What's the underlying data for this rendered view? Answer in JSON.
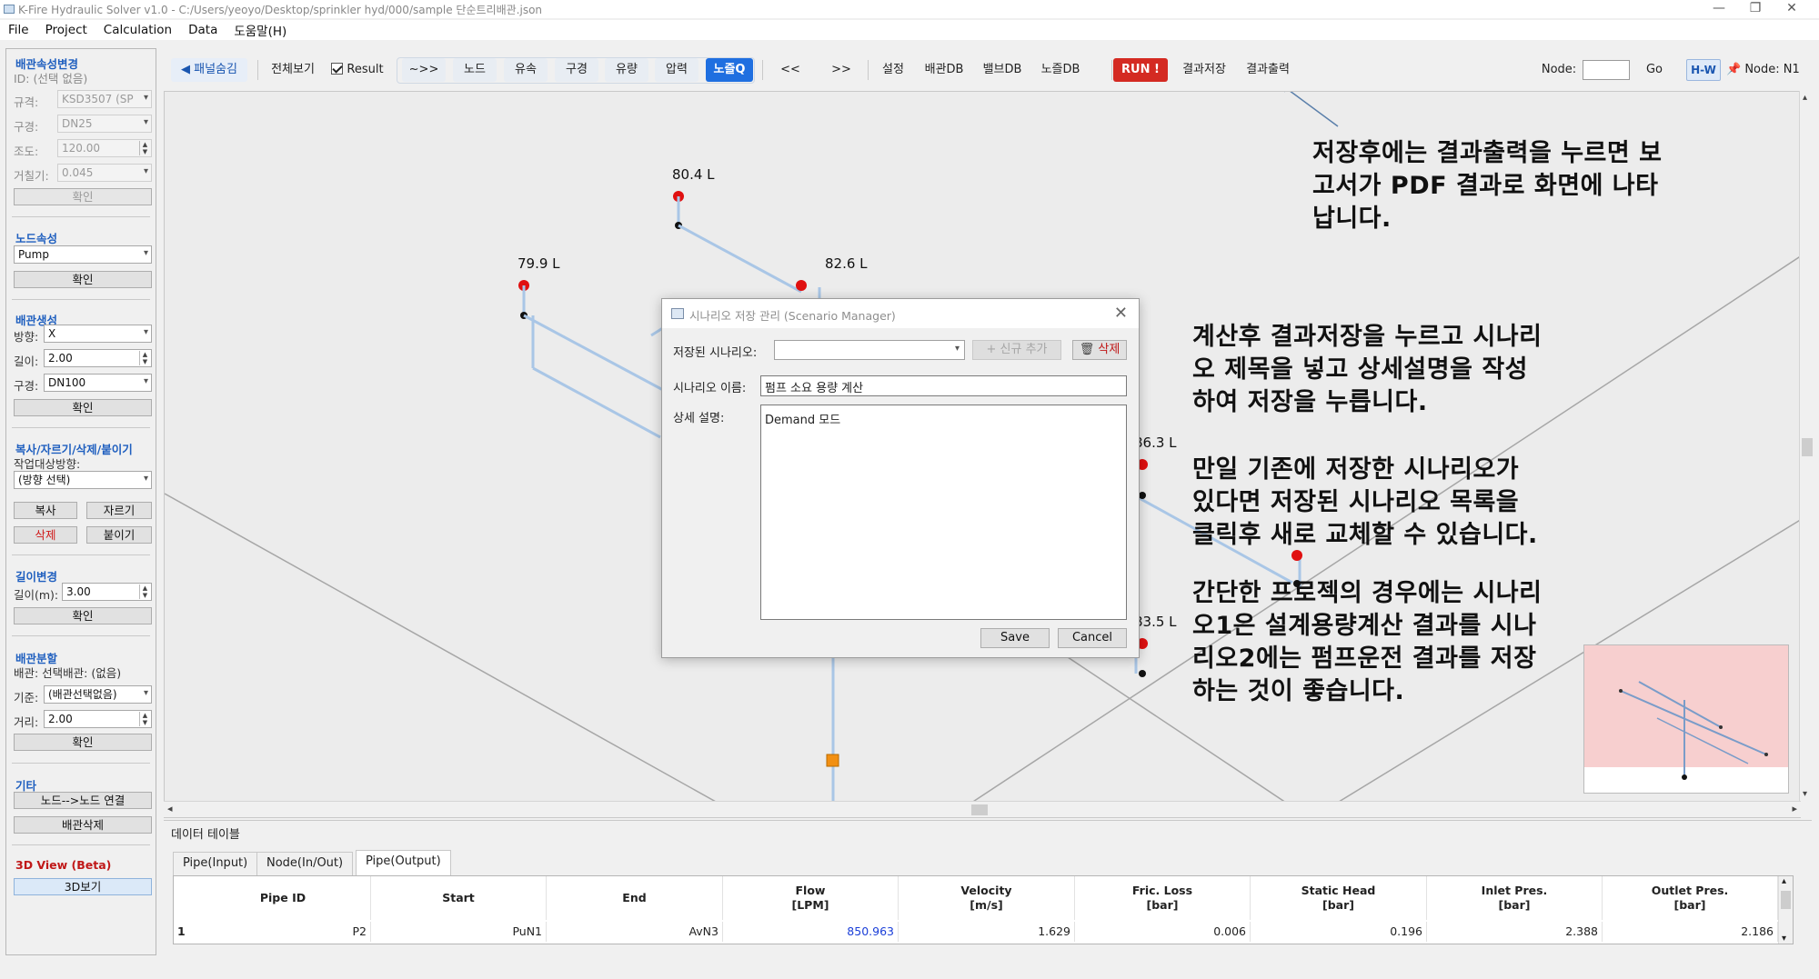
{
  "window": {
    "title": "K-Fire Hydraulic Solver v1.0 - C:/Users/yeoyo/Desktop/sprinkler hyd/000/sample 단순트리배관.json",
    "min": "—",
    "restore": "❐",
    "close": "✕"
  },
  "menu": [
    "File",
    "Project",
    "Calculation",
    "Data",
    "도움말(H)"
  ],
  "left_panel": {
    "pipe_props_title": "배관속성변경",
    "pipe_id": "ID: (선택 없음)",
    "spec_label": "규격:",
    "spec_value": "KSD3507 (SP",
    "size_label": "구경:",
    "size_value": "DN25",
    "rough_label": "조도:",
    "rough_value": "120.00",
    "abs_rough_label": "거칠기:",
    "abs_rough_value": "0.045",
    "confirm": "확인",
    "node_title": "노드속성",
    "node_type": "Pump",
    "pipe_create_title": "배관생성",
    "dir_label": "방향:",
    "dir_value": "X",
    "len_label": "길이:",
    "len_value": "2.00",
    "dn_label": "구경:",
    "dn_value": "DN100",
    "copy_title": "복사/자르기/삭제/붙이기",
    "target_dir_label": "작업대상방향:",
    "target_dir_value": "(방향 선택)",
    "copy": "복사",
    "cut": "자르기",
    "delete": "삭제",
    "paste": "붙이기",
    "length_change_title": "길이변경",
    "length_m_label": "길이(m):",
    "length_m_value": "3.00",
    "split_title": "배관분할",
    "split_pipe": "배관: 선택배관: (없음)",
    "base_label": "기준:",
    "base_value": "(배관선택없음)",
    "dist_label": "거리:",
    "dist_value": "2.00",
    "etc_title": "기타",
    "node_connect": "노드-->노드 연결",
    "pipe_delete": "배관삭제",
    "view3d_title": "3D View (Beta)",
    "view3d_btn": "3D보기"
  },
  "toolbar": {
    "hide_panel": "◀ 패널숨김",
    "view_all": "전체보기",
    "result": "Result",
    "arrows": "~>>",
    "node": "노드",
    "velocity": "유속",
    "diameter": "구경",
    "flow": "유량",
    "pressure": "압력",
    "nozzle_q": "노즐Q",
    "prev": "<<",
    "next": ">>",
    "settings": "설정",
    "pipe_db": "배관DB",
    "valve_db": "밸브DB",
    "nozzle_db": "노즐DB",
    "run": "RUN !",
    "save_result": "결과저장",
    "print_result": "결과출력",
    "node_label": "Node:",
    "go": "Go",
    "hw": "H-W",
    "node_current": "Node: N1"
  },
  "canvas": {
    "labels": [
      "80.4 L",
      "79.9 L",
      "82.6 L",
      "86.3 L",
      "83.5 L"
    ],
    "annotations": {
      "a1": [
        "저장후에는 결과출력을 누르면 보",
        "고서가 PDF 결과로 화면에 나타",
        "납니다."
      ],
      "a2": [
        "계산후 결과저장을 누르고 시나리",
        "오 제목을 넣고 상세설명을 작성",
        "하여 저장을 누릅니다."
      ],
      "a3": [
        "만일 기존에 저장한 시나리오가",
        "있다면 저장된 시나리오 목록을",
        "클릭후 새로 교체할 수 있습니다."
      ],
      "a4": [
        "간단한 프로젝의 경우에는 시나리",
        "오1은 설계용량계산 결과를 시나",
        "리오2에는 펌프운전 결과를 저장",
        "하는 것이 좋습니다."
      ]
    }
  },
  "dialog": {
    "title": "시나리오 저장 관리 (Scenario Manager)",
    "saved_label": "저장된 시나리오:",
    "add_new": "+ 신규 추가",
    "delete": "삭제",
    "name_label": "시나리오 이름:",
    "name_value": "펌프 소요 용량 계산",
    "desc_label": "상세 설명:",
    "desc_value": "Demand 모드",
    "save": "Save",
    "cancel": "Cancel"
  },
  "data_panel": {
    "title": "데이터 테이블",
    "tabs": [
      "Pipe(Input)",
      "Node(In/Out)",
      "Pipe(Output)"
    ],
    "columns": [
      [
        "Pipe ID"
      ],
      [
        "Start"
      ],
      [
        "End"
      ],
      [
        "Flow",
        "[LPM]"
      ],
      [
        "Velocity",
        "[m/s]"
      ],
      [
        "Fric. Loss",
        "[bar]"
      ],
      [
        "Static Head",
        "[bar]"
      ],
      [
        "Inlet Pres.",
        "[bar]"
      ],
      [
        "Outlet Pres.",
        "[bar]"
      ]
    ],
    "row": {
      "index": "1",
      "cells": [
        "P2",
        "PuN1",
        "AvN3",
        "850.963",
        "1.629",
        "0.006",
        "0.196",
        "2.388",
        "2.186"
      ]
    }
  },
  "colors": {
    "accent": "#1f6fe0",
    "run": "#d42a22",
    "node_red": "#e01010",
    "pipe": "#a9c6e6",
    "flow_text": "#1a3ed8"
  }
}
